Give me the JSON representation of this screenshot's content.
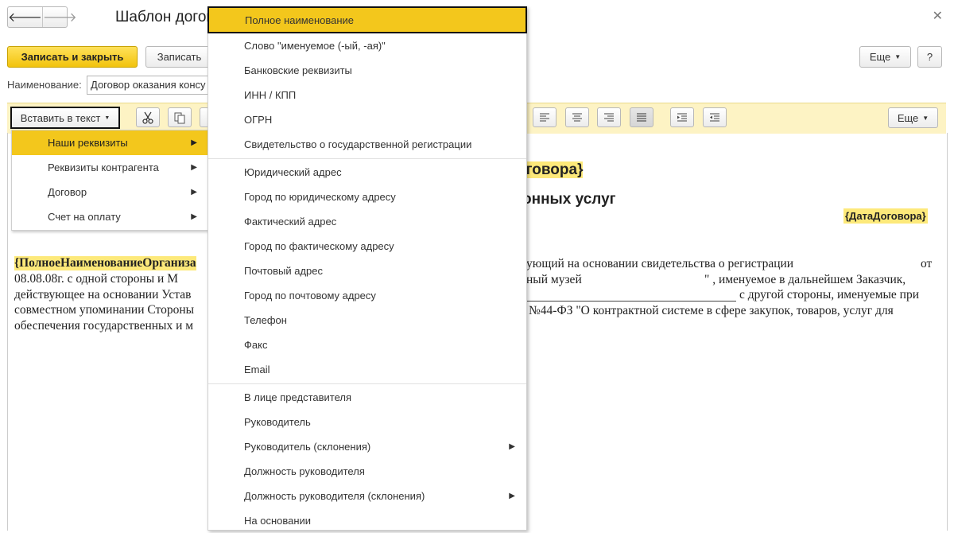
{
  "window": {
    "title": "Шаблон догово",
    "back_glyph": "🡐",
    "forward_glyph": "🡒",
    "close_glyph": "✕"
  },
  "commands": {
    "save_close": "Записать и закрыть",
    "save": "Записать",
    "more": "Еще",
    "help": "?"
  },
  "form": {
    "name_label": "Наименование:",
    "name_value": "Договор оказания консу"
  },
  "toolbar": {
    "insert_label": "Вставить в текст",
    "more": "Еще"
  },
  "submenu": {
    "items": [
      {
        "label": "Наши реквизиты",
        "active": true
      },
      {
        "label": "Реквизиты контрагента"
      },
      {
        "label": "Договор"
      },
      {
        "label": "Счет на оплату"
      }
    ]
  },
  "dropdown": {
    "items": [
      {
        "label": "Полное наименование",
        "active": true
      },
      {
        "label": "Слово \"именуемое (-ый, -ая)\""
      },
      {
        "label": "Банковские реквизиты"
      },
      {
        "label": "ИНН / КПП"
      },
      {
        "label": "ОГРН"
      },
      {
        "label": "Свидетельство о государственной регистрации"
      },
      {
        "label": "Юридический адрес"
      },
      {
        "label": "Город по юридическому адресу"
      },
      {
        "label": "Фактический адрес"
      },
      {
        "label": "Город по фактическому адресу"
      },
      {
        "label": "Почтовый адрес"
      },
      {
        "label": "Город по почтовому адресу"
      },
      {
        "label": "Телефон"
      },
      {
        "label": "Факс"
      },
      {
        "label": "Email"
      },
      {
        "label": "В лице представителя"
      },
      {
        "label": "Руководитель"
      },
      {
        "label": "Руководитель (склонения)",
        "submenu": true
      },
      {
        "label": "Должность руководителя"
      },
      {
        "label": "Должность руководителя (склонения)",
        "submenu": true
      },
      {
        "label": "На основании"
      }
    ]
  },
  "document": {
    "heading1": "оговора}",
    "heading2": "онных услуг",
    "date_field": "{ДатаДоговора}",
    "org_field": "{ПолноеНаименованиеОрганиза",
    "right_lines": [
      "ующий на основании свидетельства о регистрации",
      "ный музей",
      "\" , именуемое в дальнейшем Заказчик,",
      "с другой стороны, именуемые при",
      "№44-ФЗ \"О контрактной системе в сфере закупок, товаров, услуг для"
    ],
    "right_end": "от",
    "left_lines": [
      "08.08.08г. с одной стороны и  М",
      "действующее на основании Устав",
      "совместном упоминании Стороны",
      "обеспечения государственных и м"
    ]
  },
  "colors": {
    "accent": "#f3c71c",
    "primary_button": "#f2c30d",
    "toolbar_bg": "#fdf3c4",
    "field_highlight": "#fde97a"
  }
}
